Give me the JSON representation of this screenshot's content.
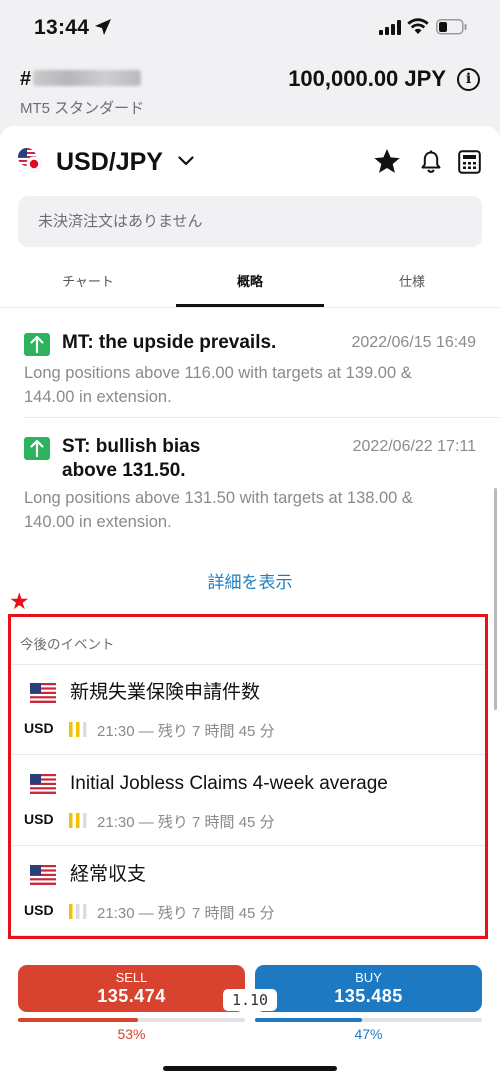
{
  "status_bar": {
    "time": "13:44"
  },
  "account": {
    "id_prefix": "#",
    "type": "MT5 スタンダード",
    "balance": "100,000.00 JPY"
  },
  "instrument": {
    "symbol": "USD/JPY"
  },
  "orders": {
    "empty_text": "未決済注文はありません"
  },
  "tabs": [
    {
      "label": "チャート"
    },
    {
      "label": "概略"
    },
    {
      "label": "仕様"
    }
  ],
  "news": [
    {
      "title": "MT: the upside prevails.",
      "date": "2022/06/15 16:49",
      "body_line1": "Long positions above 116.00 with targets at 139.00 &",
      "body_line2": "144.00 in extension."
    },
    {
      "title_line1": "ST: bullish bias",
      "title_line2": "above 131.50.",
      "date": "2022/06/22 17:11",
      "body_line1": "Long positions above 131.50 with targets at 138.00 &",
      "body_line2": "140.00 in extension."
    }
  ],
  "more_link": "詳細を表示",
  "events": {
    "heading": "今後のイベント",
    "items": [
      {
        "title": "新規失業保険申請件数",
        "currency": "USD",
        "time": "21:30 — 残り 7 時間 45 分",
        "importance": 2
      },
      {
        "title": "Initial Jobless Claims 4-week average",
        "currency": "USD",
        "time": "21:30 — 残り 7 時間 45 分",
        "importance": 2
      },
      {
        "title": "経常収支",
        "currency": "USD",
        "time": "21:30 — 残り 7 時間 45 分",
        "importance": 1
      }
    ]
  },
  "annotation": {
    "star": "★"
  },
  "trade": {
    "sell_label": "SELL",
    "sell_price": "135.474",
    "buy_label": "BUY",
    "buy_price": "135.485",
    "spread": "1.10",
    "sell_percent_text": "53%",
    "buy_percent_text": "47%",
    "sell_percent": 53,
    "buy_percent": 47
  },
  "colors": {
    "sell": "#d8432f",
    "buy": "#1d79c1",
    "bullish": "#2db35d",
    "link": "#1f7fc4",
    "highlight": "#e8101a",
    "importance": "#f2c200"
  }
}
